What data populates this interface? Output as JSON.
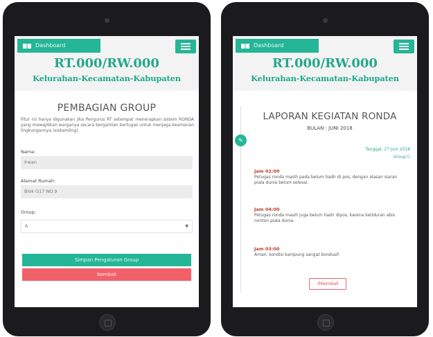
{
  "header": {
    "dashboard_label": "Dashboard",
    "site_title": "RT.000/RW.000",
    "site_subtitle": "Kelurahan-Kecamatan-Kabupaten"
  },
  "group_form": {
    "title": "PEMBAGIAN GROUP",
    "description": "Fitur ini hanya digunakan jika Pengurus RT setempat menerapkan sistem RONDA yang mewajibkan warganya secara bergantian bertugas untuk menjaga keamanan lingkungannya (siskamling).",
    "name_label": "Nama:",
    "name_value": "Irwan",
    "address_label": "Alamat Rumah:",
    "address_value": "Blok G17 NO.9",
    "group_label": "Group:",
    "group_value": "A",
    "save_label": "Simpan Pengaturan Group",
    "back_label": "Kembali"
  },
  "report": {
    "title": "LAPORAN KEGIATAN RONDA",
    "month": "BULAN : JUNI 2018",
    "date": "Tanggal, 27 Juni 2018",
    "group": "Group C",
    "entries": [
      {
        "time": "Jam 02:00",
        "desc": "Petugas ronda masih pada belum hadir di pos, dengan alasan siaran piala dunia belum selesai."
      },
      {
        "time": "Jam 04:00",
        "desc": "Petugas ronda masih juga belum hadir dipos, karena ketiduran abis nonton piala dunia."
      },
      {
        "time": "Jam 03:00",
        "desc": "Aman, kondisi kampung sangat kondusif."
      }
    ],
    "back_label": "Kembali"
  },
  "colors": {
    "accent": "#25b597",
    "danger": "#f2606a",
    "time_text": "#c0392b",
    "device": "#1b1b1d"
  },
  "icons": [
    "grid-icon",
    "hamburger-icon",
    "edit-icon",
    "undo-icon",
    "home-button"
  ]
}
